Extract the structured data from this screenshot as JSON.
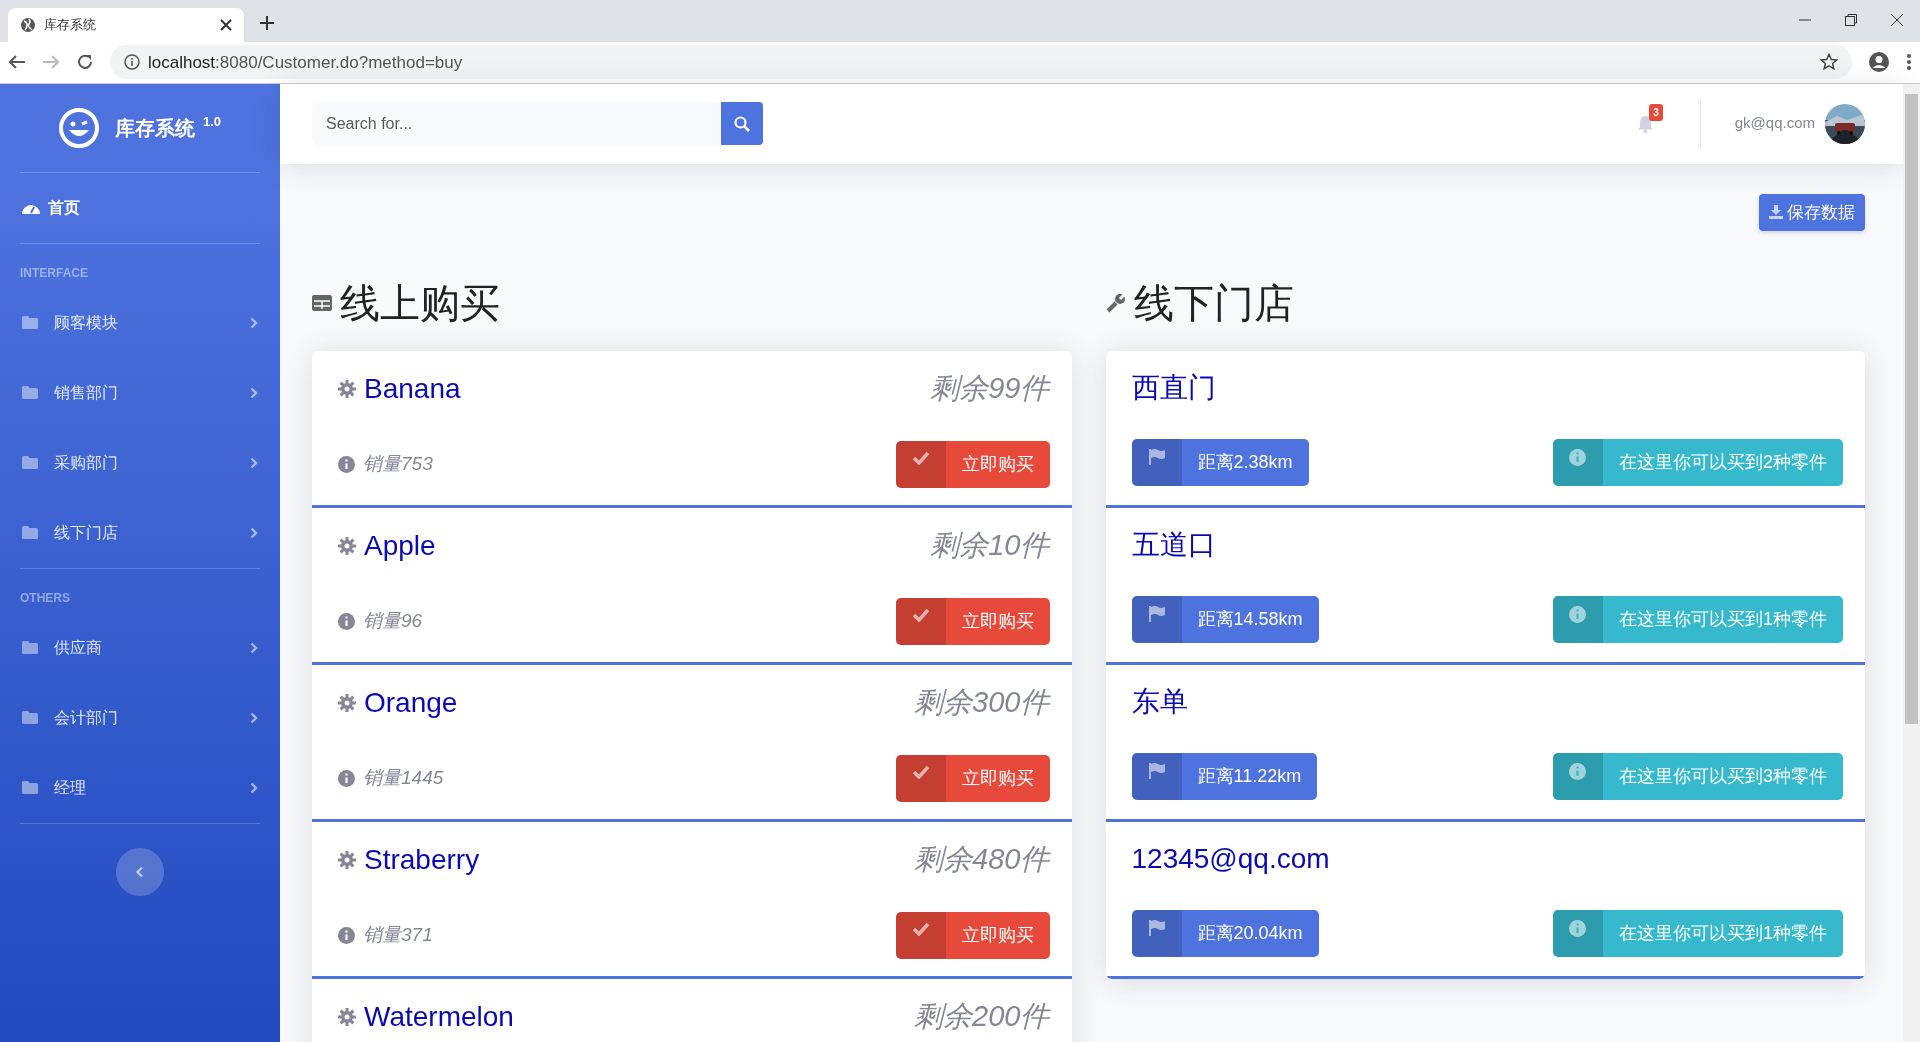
{
  "browser": {
    "tab_title": "库存系统",
    "url_host": "localhost",
    "url_rest": ":8080/Customer.do?method=buy"
  },
  "sidebar": {
    "brand": "库存系统",
    "version": "1.0",
    "home": {
      "label": "首页",
      "selected": true
    },
    "sections": [
      {
        "heading": "INTERFACE",
        "items": [
          {
            "label": "顾客模块",
            "selected": false
          },
          {
            "label": "销售部门",
            "selected": false
          },
          {
            "label": "采购部门",
            "selected": false
          },
          {
            "label": "线下门店",
            "selected": false
          }
        ]
      },
      {
        "heading": "OTHERS",
        "items": [
          {
            "label": "供应商",
            "selected": false
          },
          {
            "label": "会计部门",
            "selected": false
          },
          {
            "label": "经理",
            "selected": false
          }
        ]
      }
    ]
  },
  "topbar": {
    "search": {
      "placeholder": "Search for..."
    },
    "notifications": "3",
    "user": "gk@qq.com"
  },
  "save_button": "保存数据",
  "online": {
    "title": "线上购买",
    "products": [
      {
        "name": "Banana",
        "remaining": "剩余99件",
        "sales": "销量753",
        "button": "立即购买"
      },
      {
        "name": "Apple",
        "remaining": "剩余10件",
        "sales": "销量96",
        "button": "立即购买"
      },
      {
        "name": "Orange",
        "remaining": "剩余300件",
        "sales": "销量1445",
        "button": "立即购买"
      },
      {
        "name": "Straberry",
        "remaining": "剩余480件",
        "sales": "销量371",
        "button": "立即购买"
      },
      {
        "name": "Watermelon",
        "remaining": "剩余200件"
      }
    ]
  },
  "offline": {
    "title": "线下门店",
    "stores": [
      {
        "name": "西直门",
        "distance": "距离2.38km",
        "info": "在这里你可以买到2种零件"
      },
      {
        "name": "五道口",
        "distance": "距离14.58km",
        "info": "在这里你可以买到1种零件"
      },
      {
        "name": "东单",
        "distance": "距离11.22km",
        "info": "在这里你可以买到3种零件"
      },
      {
        "name": "12345@qq.com",
        "distance": "距离20.04km",
        "info": "在这里你可以买到1种零件"
      }
    ]
  }
}
